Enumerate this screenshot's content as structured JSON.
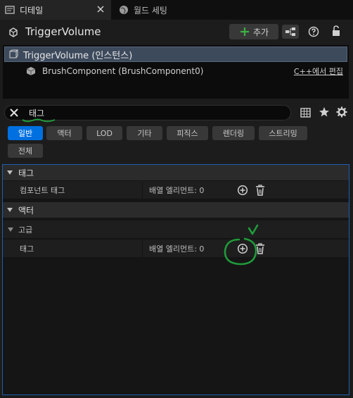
{
  "tabs": [
    {
      "label": "디테일",
      "icon": "details-icon"
    },
    {
      "label": "월드 세팅",
      "icon": "globe-icon"
    }
  ],
  "header": {
    "title": "TriggerVolume",
    "add_button_label": "추가"
  },
  "tree": {
    "actor_label": "TriggerVolume (인스턴스)",
    "component_label": "BrushComponent (BrushComponent0)",
    "edit_cpp_label": "C++에서 편집"
  },
  "search": {
    "value": "태그"
  },
  "filters": [
    "일반",
    "액터",
    "LOD",
    "기타",
    "피직스",
    "렌더링",
    "스트리밍",
    "전체"
  ],
  "details": {
    "categories": [
      {
        "label": "태그"
      },
      {
        "label": "액터"
      }
    ],
    "subcategory": "고급",
    "properties": [
      {
        "name": "컴포넌트 태그",
        "value": "배열 엘리먼트: 0"
      },
      {
        "name": "태그",
        "value": "배열 엘리먼트: 0"
      }
    ]
  },
  "colors": {
    "accent_blue": "#0070e0",
    "add_green": "#3cb043",
    "annotation_green": "#1f9a3a",
    "selection": "#3d4a5c"
  }
}
